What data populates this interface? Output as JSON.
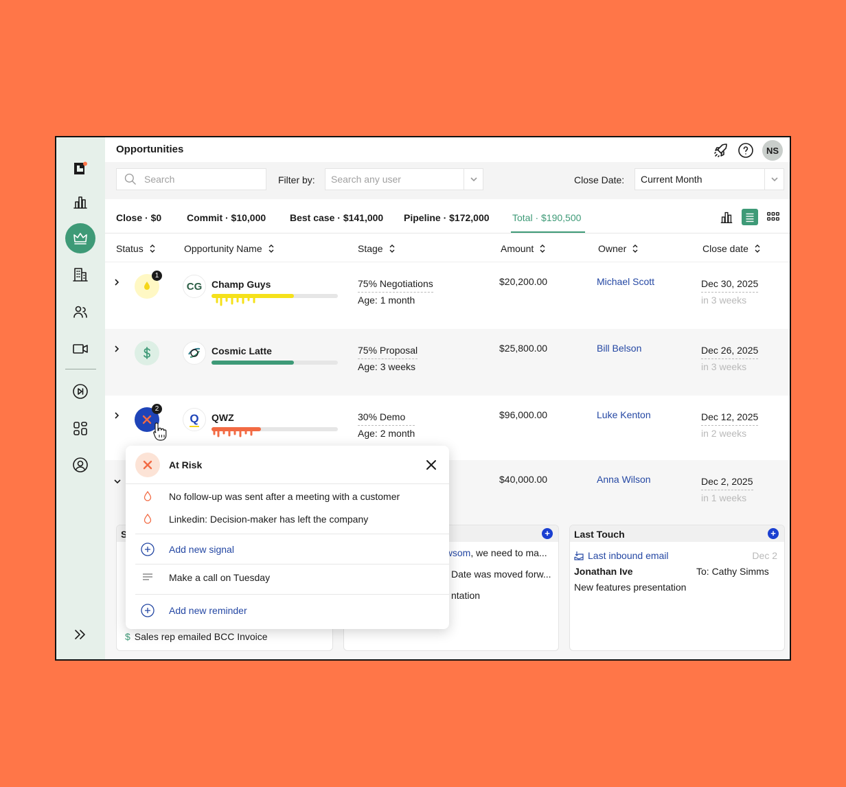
{
  "header": {
    "title": "Opportunities",
    "avatar_initials": "NS"
  },
  "filters": {
    "search_placeholder": "Search",
    "filter_label": "Filter by:",
    "user_placeholder": "Search any user",
    "close_date_label": "Close Date:",
    "close_date_value": "Current Month"
  },
  "tabs": [
    {
      "label": "Close · $0"
    },
    {
      "label": "Commit · $10,000"
    },
    {
      "label": "Best case · $141,000"
    },
    {
      "label": "Pipeline · $172,000"
    },
    {
      "label": "Total · $190,500"
    }
  ],
  "columns": [
    "Status",
    "Opportunity Name",
    "Stage",
    "Amount",
    "Owner",
    "Close date"
  ],
  "rows": [
    {
      "name": "Champ Guys",
      "logo": "CG",
      "stage": "75% Negotiations",
      "age": "Age: 1 month",
      "amount": "$20,200.00",
      "owner": "Michael Scott",
      "close_date": "Dec 30, 2025",
      "close_in": "in 3 weeks",
      "badge": "1",
      "progress": 0.65,
      "status_color": "#F5E11A"
    },
    {
      "name": "Cosmic Latte",
      "logo": "",
      "stage": "75% Proposal",
      "age": "Age: 3 weeks",
      "amount": "$25,800.00",
      "owner": "Bill Belson",
      "close_date": "Dec 26, 2025",
      "close_in": "in 3 weeks",
      "badge": "",
      "progress": 0.65,
      "status_color": "#3E9A77"
    },
    {
      "name": "QWZ",
      "logo": "Q",
      "stage": "30% Demo",
      "age": "Age: 2 month",
      "amount": "$96,000.00",
      "owner": "Luke Kenton",
      "close_date": "Dec 12, 2025",
      "close_in": "in 2 weeks",
      "badge": "2",
      "progress": 0.39,
      "status_color": "#F26A43"
    },
    {
      "name": "",
      "logo": "",
      "stage": "",
      "age": "",
      "amount": "$40,000.00",
      "owner": "Anna Wilson",
      "close_date": "Dec 2, 2025",
      "close_in": "in 1 weeks",
      "badge": "",
      "progress": 0,
      "status_color": ""
    }
  ],
  "cards": {
    "left_bottom": "Sales rep emailed BCC Invoice",
    "middle": {
      "line1_link": "ewsom",
      "line1_rest": ", we need to ma...",
      "line2": "Date was moved forw...",
      "line3": "ntation"
    },
    "last_touch": {
      "title": "Last Touch",
      "link": "Last inbound email",
      "date": "Dec 2",
      "from": "Jonathan Ive",
      "to": "To: Cathy Simms",
      "subject": "New features presentation"
    }
  },
  "popup": {
    "title": "At Risk",
    "signals": [
      "No follow-up was sent after a meeting with a customer",
      "Linkedin: Decision-maker has left the company"
    ],
    "add_signal": "Add new signal",
    "reminder": "Make a call on Tuesday",
    "add_reminder": "Add new reminder"
  },
  "colors": {
    "accent": "#3E9A77",
    "background": "#FF7648",
    "sidebar": "#E6F0EA",
    "link": "#2447a3",
    "risk": "#F26A43"
  }
}
